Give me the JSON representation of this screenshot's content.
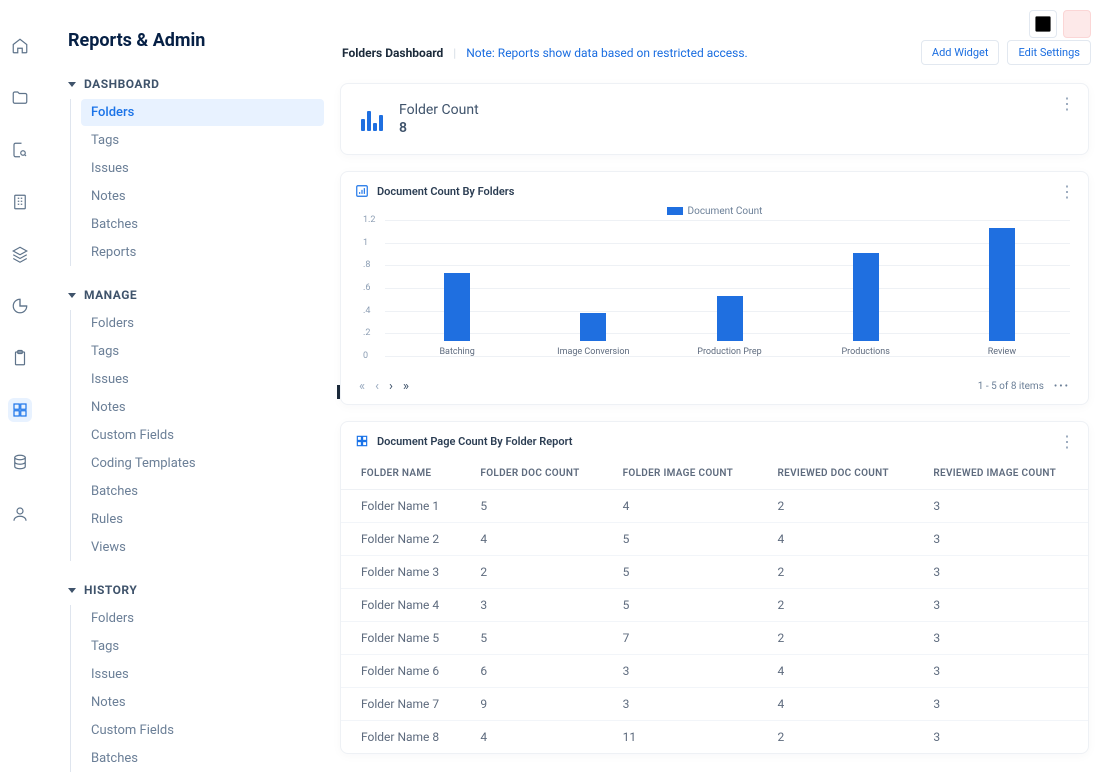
{
  "page_title": "Reports & Admin",
  "rail": [
    {
      "name": "home-icon"
    },
    {
      "name": "folder-icon"
    },
    {
      "name": "search-file-icon"
    },
    {
      "name": "building-icon"
    },
    {
      "name": "layers-icon"
    },
    {
      "name": "pie-icon"
    },
    {
      "name": "clipboard-icon"
    },
    {
      "name": "dashboard-icon",
      "active": true
    },
    {
      "name": "database-icon"
    },
    {
      "name": "user-icon"
    }
  ],
  "nav": [
    {
      "label": "DASHBOARD",
      "items": [
        "Folders",
        "Tags",
        "Issues",
        "Notes",
        "Batches",
        "Reports"
      ],
      "active": "Folders"
    },
    {
      "label": "MANAGE",
      "items": [
        "Folders",
        "Tags",
        "Issues",
        "Notes",
        "Custom Fields",
        "Coding Templates",
        "Batches",
        "Rules",
        "Views"
      ]
    },
    {
      "label": "HISTORY",
      "items": [
        "Folders",
        "Tags",
        "Issues",
        "Notes",
        "Custom Fields",
        "Batches"
      ]
    }
  ],
  "top": {
    "title": "Folders Dashboard",
    "note": "Note: Reports show data based on restricted access.",
    "add_widget": "Add Widget",
    "edit_settings": "Edit Settings"
  },
  "kpi": {
    "title": "Folder Count",
    "value": "8"
  },
  "chart_data": {
    "type": "bar",
    "title": "Document Count By Folders",
    "legend": "Document Count",
    "categories": [
      "Batching",
      "Image Conversion",
      "Production Prep",
      "Productions",
      "Review"
    ],
    "values": [
      0.6,
      0.25,
      0.4,
      0.78,
      1.0
    ],
    "ylim": [
      0,
      1.2
    ],
    "yticks": [
      0,
      0.2,
      0.4,
      0.6,
      0.8,
      1,
      1.2
    ],
    "pager": "1 - 5 of 8 items"
  },
  "table": {
    "title": "Document Page Count By Folder Report",
    "columns": [
      "FOLDER NAME",
      "FOLDER DOC COUNT",
      "FOLDER IMAGE COUNT",
      "REVIEWED DOC COUNT",
      "REVIEWED IMAGE COUNT"
    ],
    "rows": [
      [
        "Folder Name 1",
        "5",
        "4",
        "2",
        "3"
      ],
      [
        "Folder Name 2",
        "4",
        "5",
        "4",
        "3"
      ],
      [
        "Folder Name 3",
        "2",
        "5",
        "2",
        "3"
      ],
      [
        "Folder Name 4",
        "3",
        "5",
        "2",
        "3"
      ],
      [
        "Folder Name 5",
        "5",
        "7",
        "2",
        "3"
      ],
      [
        "Folder Name 6",
        "6",
        "3",
        "4",
        "3"
      ],
      [
        "Folder Name 7",
        "9",
        "3",
        "4",
        "3"
      ],
      [
        "Folder Name 8",
        "4",
        "11",
        "2",
        "3"
      ]
    ]
  }
}
